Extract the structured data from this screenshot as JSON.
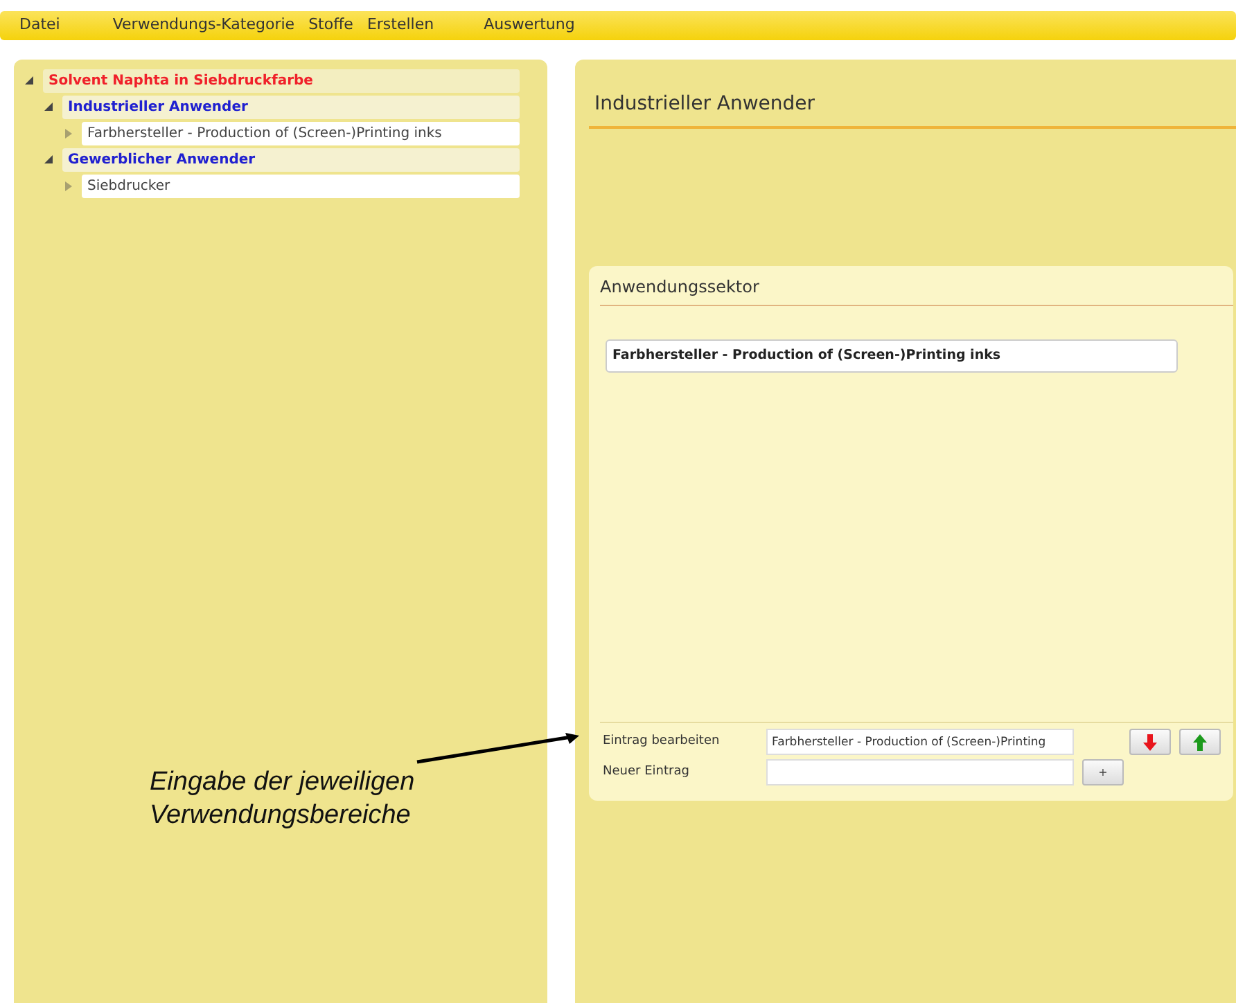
{
  "menu": [
    {
      "label": "Datei"
    },
    {
      "label": "Verwendungs-Kategorie"
    },
    {
      "label": "Stoffe"
    },
    {
      "label": "Erstellen"
    },
    {
      "label": "Auswertung"
    }
  ],
  "tree": [
    {
      "label": "Solvent Naphta in Siebdruckfarbe",
      "expanded": true,
      "children": [
        {
          "label": "Industrieller Anwender",
          "expanded": true,
          "children": [
            {
              "label": "Farbhersteller - Production of (Screen-)Printing inks",
              "expanded": false
            }
          ]
        },
        {
          "label": "Gewerblicher Anwender",
          "expanded": true,
          "children": [
            {
              "label": "Siebdrucker",
              "expanded": false
            }
          ]
        }
      ]
    }
  ],
  "detail": {
    "title": "Industrieller Anwender"
  },
  "sector": {
    "title": "Anwendungssektor",
    "entries": [
      {
        "label": "Farbhersteller - Production of (Screen-)Printing inks",
        "selected": true
      }
    ],
    "edit_label": "Eintrag bearbeiten",
    "edit_value": "Farbhersteller - Production of (Screen-)Printing",
    "new_label": "Neuer Eintrag",
    "add_button": "+"
  },
  "annotation": {
    "text": "Eingabe der jeweiligen Verwendungsbereiche"
  }
}
